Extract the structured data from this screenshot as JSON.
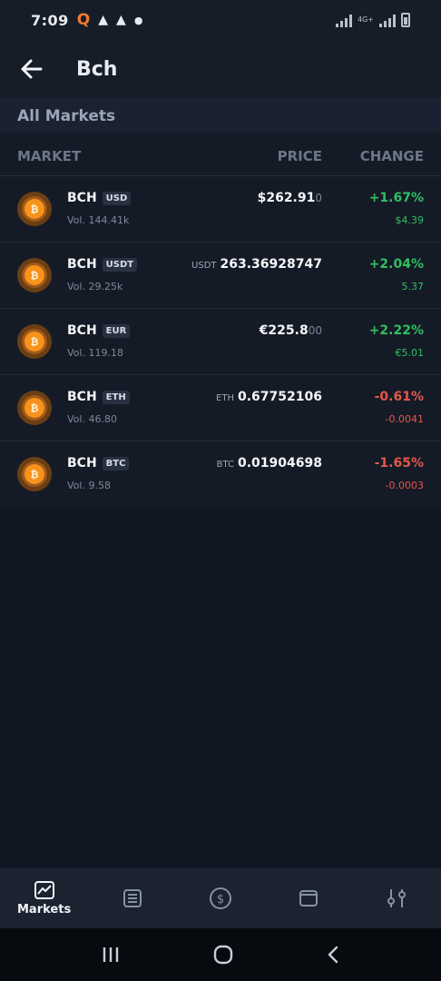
{
  "status": {
    "time": "7:09",
    "network": "4G+"
  },
  "header": {
    "title": "Bch"
  },
  "section": {
    "title": "All Markets"
  },
  "columns": {
    "market": "MARKET",
    "price": "PRICE",
    "change": "CHANGE"
  },
  "markets": [
    {
      "base": "BCH",
      "quote": "USD",
      "volume": "Vol. 144.41k",
      "price_unit": "",
      "price": "$262.91",
      "price_faint": "0",
      "change_pct": "+1.67%",
      "change_abs": "$4.39",
      "direction": "up"
    },
    {
      "base": "BCH",
      "quote": "USDT",
      "volume": "Vol. 29.25k",
      "price_unit": "USDT",
      "price": "263.36928747",
      "price_faint": "",
      "change_pct": "+2.04%",
      "change_abs": "5.37",
      "direction": "up"
    },
    {
      "base": "BCH",
      "quote": "EUR",
      "volume": "Vol. 119.18",
      "price_unit": "",
      "price": "€225.8",
      "price_faint": "00",
      "change_pct": "+2.22%",
      "change_abs": "€5.01",
      "direction": "up"
    },
    {
      "base": "BCH",
      "quote": "ETH",
      "volume": "Vol. 46.80",
      "price_unit": "ETH",
      "price": "0.67752106",
      "price_faint": "",
      "change_pct": "-0.61%",
      "change_abs": "-0.0041",
      "direction": "down"
    },
    {
      "base": "BCH",
      "quote": "BTC",
      "volume": "Vol. 9.58",
      "price_unit": "BTC",
      "price": "0.01904698",
      "price_faint": "",
      "change_pct": "-1.65%",
      "change_abs": "-0.0003",
      "direction": "down"
    }
  ],
  "nav": {
    "markets": "Markets"
  },
  "colors": {
    "up": "#2fbf62",
    "down": "#e4574b",
    "coin": "#f7931a"
  },
  "icons": {
    "coin": "bitcoin-cash-icon"
  }
}
